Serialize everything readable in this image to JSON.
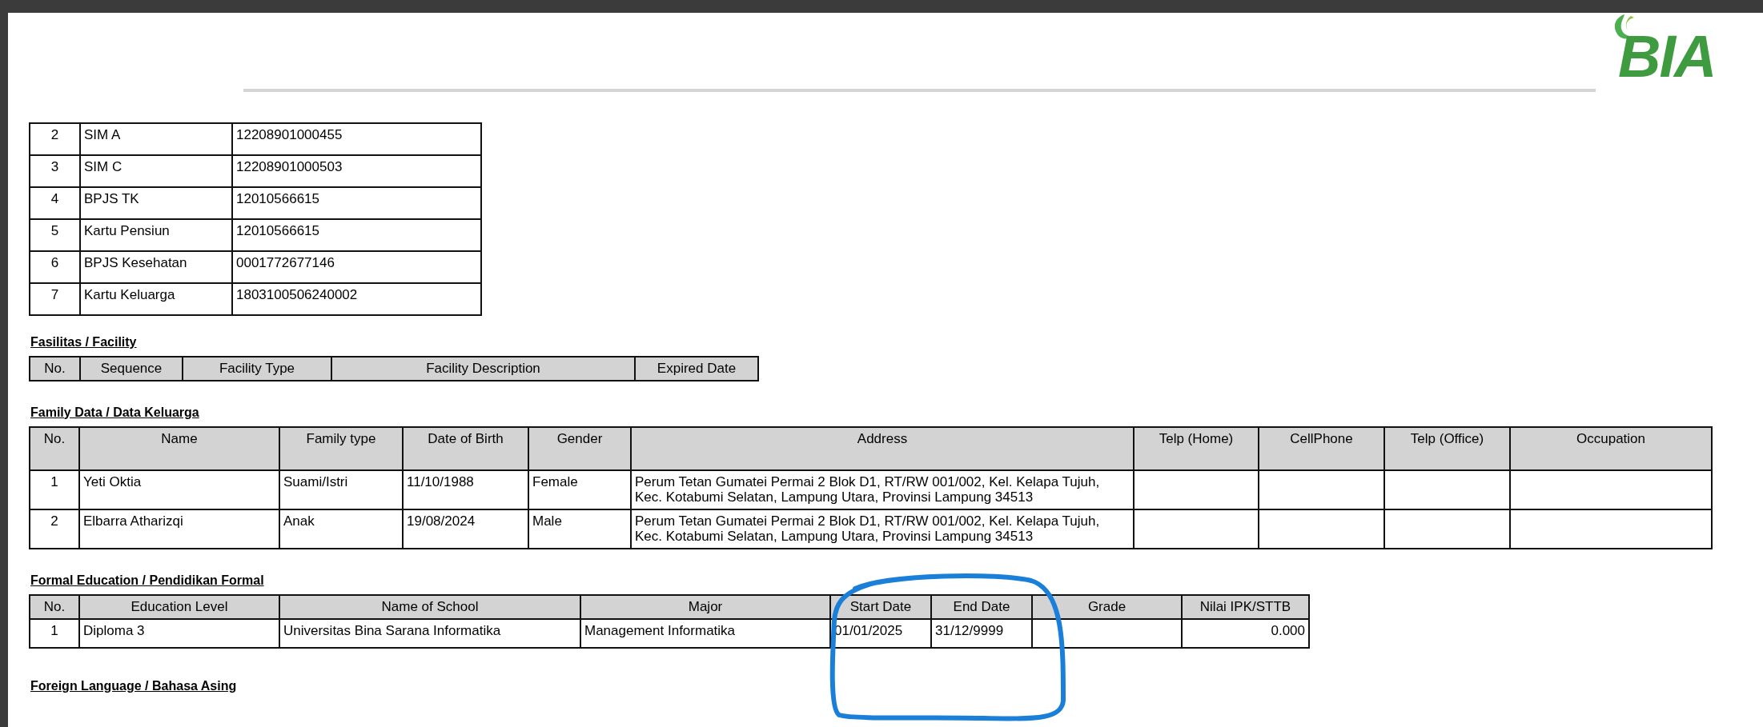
{
  "logo": {
    "text": "BIA"
  },
  "identity_documents": {
    "rows": [
      {
        "no": "2",
        "name": "SIM A",
        "number": "12208901000455"
      },
      {
        "no": "3",
        "name": "SIM C",
        "number": "12208901000503"
      },
      {
        "no": "4",
        "name": "BPJS TK",
        "number": "12010566615"
      },
      {
        "no": "5",
        "name": "Kartu Pensiun",
        "number": "12010566615"
      },
      {
        "no": "6",
        "name": "BPJS Kesehatan",
        "number": "0001772677146"
      },
      {
        "no": "7",
        "name": "Kartu Keluarga",
        "number": "1803100506240002"
      }
    ]
  },
  "facility": {
    "title": "Fasilitas / Facility",
    "columns": [
      "No.",
      "Sequence",
      "Facility Type",
      "Facility Description",
      "Expired Date"
    ]
  },
  "family": {
    "title": "Family Data / Data Keluarga",
    "columns": [
      "No.",
      "Name",
      "Family type",
      "Date of Birth",
      "Gender",
      "Address",
      "Telp (Home)",
      "CellPhone",
      "Telp (Office)",
      "Occupation"
    ],
    "rows": [
      {
        "no": "1",
        "name": "Yeti Oktia",
        "family_type": "Suami/Istri",
        "date_of_birth": "11/10/1988",
        "gender": "Female",
        "address": "Perum Tetan Gumatei Permai 2 Blok D1, RT/RW 001/002, Kel. Kelapa Tujuh, Kec. Kotabumi Selatan, Lampung Utara, Provinsi Lampung 34513"
      },
      {
        "no": "2",
        "name": "Elbarra Atharizqi",
        "family_type": "Anak",
        "date_of_birth": "19/08/2024",
        "gender": "Male",
        "address": "Perum Tetan Gumatei Permai 2 Blok D1, RT/RW 001/002, Kel. Kelapa Tujuh, Kec. Kotabumi Selatan, Lampung Utara, Provinsi Lampung 34513"
      }
    ]
  },
  "formal_education": {
    "title": "Formal Education / Pendidikan Formal",
    "columns": [
      "No.",
      "Education Level",
      "Name of School",
      "Major",
      "Start Date",
      "End Date",
      "Grade",
      "Nilai IPK/STTB"
    ],
    "rows": [
      {
        "no": "1",
        "education_level": "Diploma 3",
        "school": "Universitas Bina Sarana Informatika",
        "major": "Management Informatika",
        "start_date": "01/01/2025",
        "end_date": "31/12/9999",
        "gpa": "0.000"
      }
    ]
  },
  "foreign_language": {
    "title": "Foreign Language / Bahasa Asing"
  }
}
